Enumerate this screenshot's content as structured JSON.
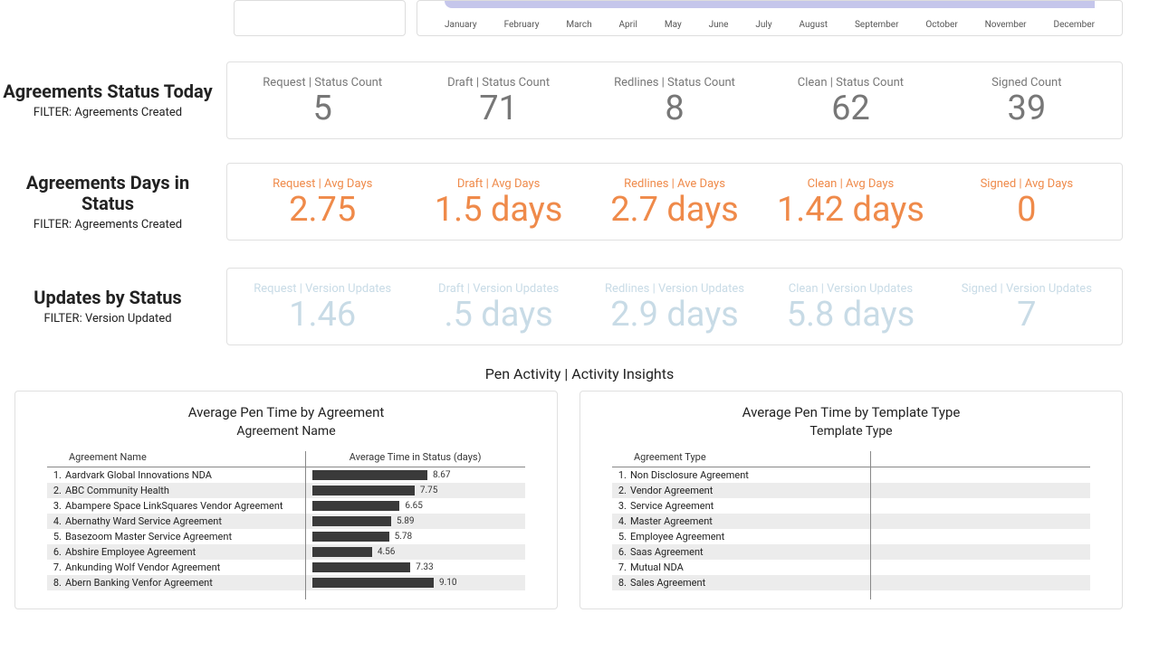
{
  "months": [
    "January",
    "February",
    "March",
    "April",
    "May",
    "June",
    "July",
    "August",
    "September",
    "October",
    "November",
    "December"
  ],
  "rows": {
    "status_today": {
      "title": "Agreements Status Today",
      "filter": "FILTER: Agreements Created",
      "metrics": [
        {
          "label": "Request | Status Count",
          "value": "5"
        },
        {
          "label": "Draft | Status Count",
          "value": "71"
        },
        {
          "label": "Redlines | Status Count",
          "value": "8"
        },
        {
          "label": "Clean | Status Count",
          "value": "62"
        },
        {
          "label": "Signed Count",
          "value": "39"
        }
      ]
    },
    "days_in_status": {
      "title": "Agreements Days in Status",
      "filter": "FILTER: Agreements Created",
      "metrics": [
        {
          "label": "Request | Avg Days",
          "value": "2.75"
        },
        {
          "label": "Draft | Avg Days",
          "value": "1.5 days"
        },
        {
          "label": "Redlines | Ave Days",
          "value": "2.7 days"
        },
        {
          "label": "Clean | Avg Days",
          "value": "1.42 days"
        },
        {
          "label": "Signed | Avg Days",
          "value": "0"
        }
      ]
    },
    "updates_by_status": {
      "title": "Updates by Status",
      "filter": "FILTER: Version Updated",
      "metrics": [
        {
          "label": "Request | Version Updates",
          "value": "1.46"
        },
        {
          "label": "Draft | Version Updates",
          "value": ".5 days"
        },
        {
          "label": "Redlines | Version Updates",
          "value": "2.9 days"
        },
        {
          "label": "Clean | Version Updates",
          "value": "5.8 days"
        },
        {
          "label": "Signed | Version Updates",
          "value": "7"
        }
      ]
    }
  },
  "section_title": "Pen Activity | Activity Insights",
  "left_table": {
    "title": "Average Pen Time by Agreement",
    "subtitle": "Agreement Name",
    "col1": "Agreement Name",
    "col2": "Average Time in Status (days)",
    "rows": [
      {
        "idx": "1.",
        "name": "Aardvark Global Innovations NDA",
        "val": "8.67",
        "pct": 54
      },
      {
        "idx": "2.",
        "name": "ABC Community Health",
        "val": "7.75",
        "pct": 48
      },
      {
        "idx": "3.",
        "name": "Abampere Space LinkSquares Vendor Agreement",
        "val": "6.65",
        "pct": 41
      },
      {
        "idx": "4.",
        "name": "Abernathy Ward Service Agreement",
        "val": "5.89",
        "pct": 37
      },
      {
        "idx": "5.",
        "name": "Basezoom Master Service Agreement",
        "val": "5.78",
        "pct": 36
      },
      {
        "idx": "6.",
        "name": "Abshire Employee Agreement",
        "val": "4.56",
        "pct": 28
      },
      {
        "idx": "7.",
        "name": "Ankunding Wolf Vendor Agreement",
        "val": "7.33",
        "pct": 46
      },
      {
        "idx": "8.",
        "name": "Abern Banking Venfor Agreement",
        "val": "9.10",
        "pct": 57
      }
    ]
  },
  "right_table": {
    "title": "Average Pen Time by Template Type",
    "subtitle": "Template Type",
    "col1": "Agreement Type",
    "col2": "",
    "rows": [
      {
        "idx": "1.",
        "name": "Non Disclosure Agreement"
      },
      {
        "idx": "2.",
        "name": "Vendor Agreement"
      },
      {
        "idx": "3.",
        "name": "Service Agreement"
      },
      {
        "idx": "4.",
        "name": "Master Agreement"
      },
      {
        "idx": "5.",
        "name": "Employee Agreement"
      },
      {
        "idx": "6.",
        "name": "Saas Agreement"
      },
      {
        "idx": "7.",
        "name": "Mutual NDA"
      },
      {
        "idx": "8.",
        "name": "Sales Agreement"
      }
    ]
  },
  "chart_data": [
    {
      "type": "table",
      "title": "Agreements Status Today",
      "categories": [
        "Request",
        "Draft",
        "Redlines",
        "Clean",
        "Signed"
      ],
      "values": [
        5,
        71,
        8,
        62,
        39
      ],
      "ylabel": "Status Count"
    },
    {
      "type": "table",
      "title": "Agreements Days in Status",
      "categories": [
        "Request",
        "Draft",
        "Redlines",
        "Clean",
        "Signed"
      ],
      "values": [
        2.75,
        1.5,
        2.7,
        1.42,
        0
      ],
      "ylabel": "Avg Days"
    },
    {
      "type": "table",
      "title": "Updates by Status",
      "categories": [
        "Request",
        "Draft",
        "Redlines",
        "Clean",
        "Signed"
      ],
      "values": [
        1.46,
        0.5,
        2.9,
        5.8,
        7
      ],
      "ylabel": "Version Updates"
    },
    {
      "type": "bar",
      "title": "Average Pen Time by Agreement",
      "xlabel": "Agreement Name",
      "ylabel": "Average Time in Status (days)",
      "categories": [
        "Aardvark Global Innovations NDA",
        "ABC Community Health",
        "Abampere Space LinkSquares Vendor Agreement",
        "Abernathy Ward Service Agreement",
        "Basezoom Master Service Agreement",
        "Abshire Employee Agreement",
        "Ankunding Wolf Vendor Agreement",
        "Abern Banking Venfor Agreement"
      ],
      "values": [
        8.67,
        7.75,
        6.65,
        5.89,
        5.78,
        4.56,
        7.33,
        9.1
      ],
      "ylim": [
        0,
        10
      ]
    },
    {
      "type": "table",
      "title": "Average Pen Time by Template Type",
      "xlabel": "Template Type",
      "categories": [
        "Non Disclosure Agreement",
        "Vendor Agreement",
        "Service Agreement",
        "Master Agreement",
        "Employee Agreement",
        "Saas Agreement",
        "Mutual NDA",
        "Sales Agreement"
      ]
    }
  ]
}
